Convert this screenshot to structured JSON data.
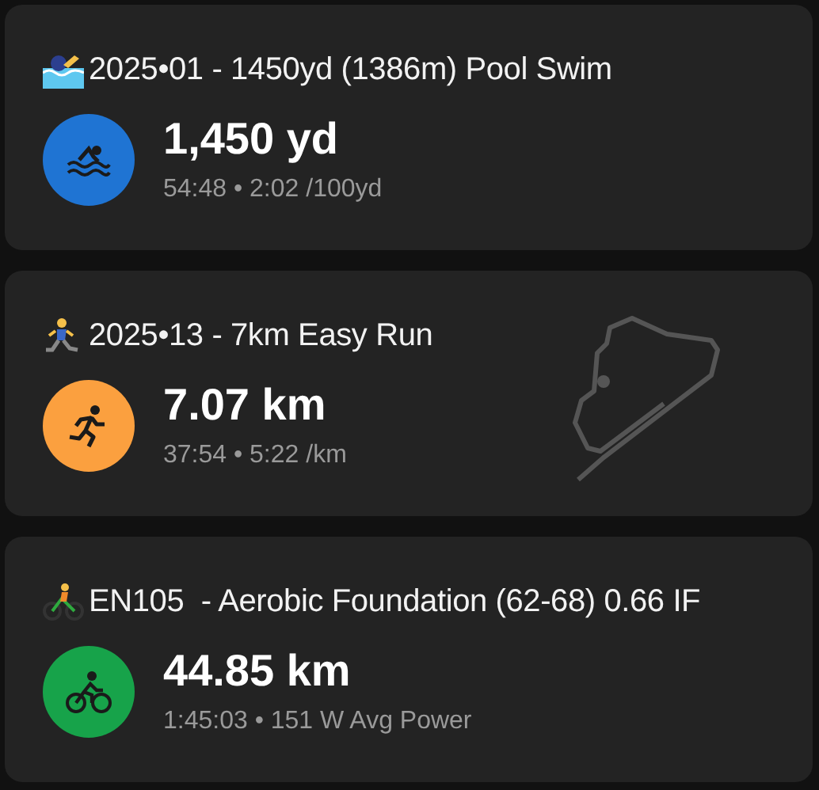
{
  "activities": [
    {
      "kind": "swim",
      "color": "#1f74d3",
      "title": "2025•01 - 1450yd (1386m) Pool Swim",
      "distance": "1,450 yd",
      "details": "54:48 • 2:02 /100yd",
      "route_shown": false
    },
    {
      "kind": "run",
      "color": "#fba03f",
      "title": "2025•13 - 7km Easy Run",
      "distance": "7.07 km",
      "details": "37:54 • 5:22 /km",
      "route_shown": true
    },
    {
      "kind": "ride",
      "color": "#17a34a",
      "title": "EN105  - Aerobic Foundation (62-68) 0.66 IF",
      "distance": "44.85 km",
      "details": "1:45:03 • 151 W Avg Power",
      "route_shown": false
    }
  ]
}
